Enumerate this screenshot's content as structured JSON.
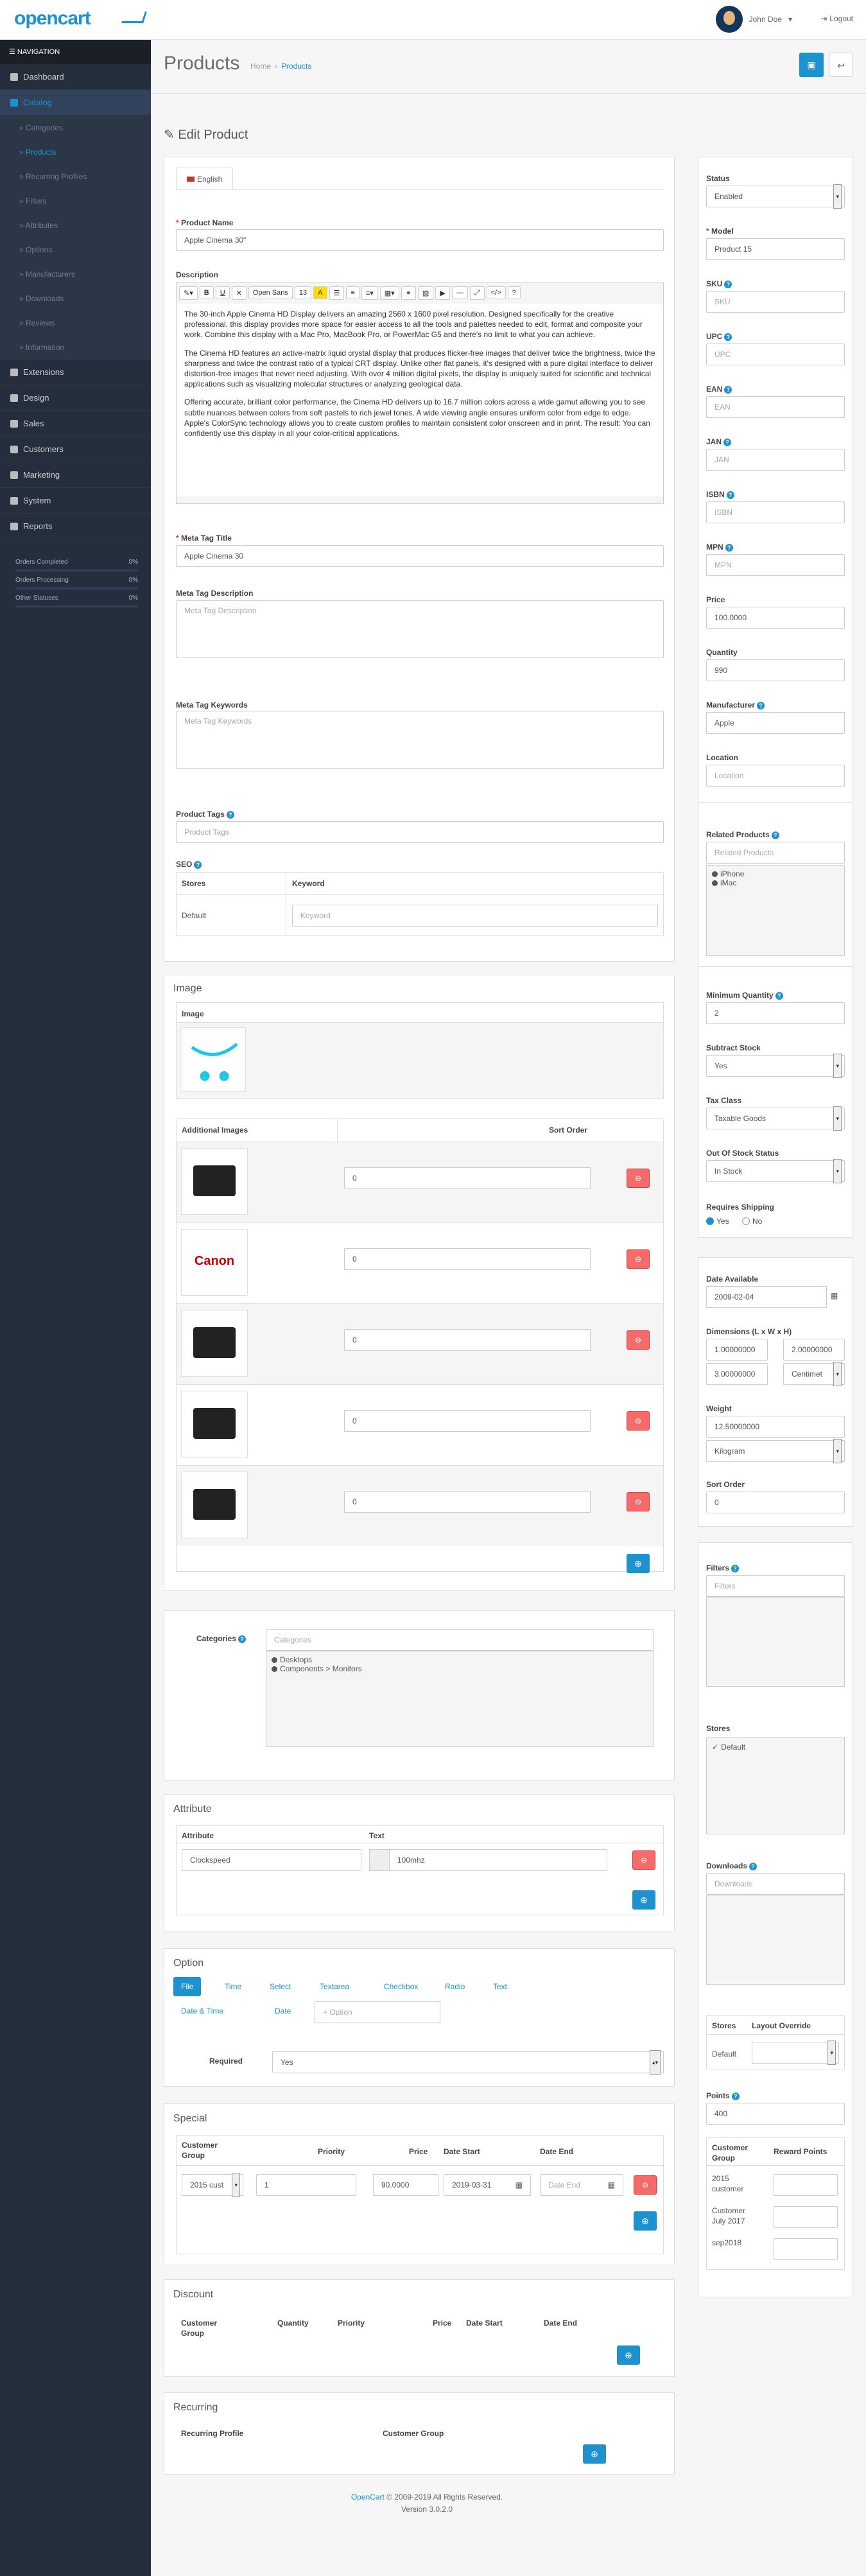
{
  "header": {
    "logo": "opencart",
    "user": "John Doe",
    "logout": "Logout"
  },
  "nav": {
    "title": "NAVIGATION",
    "items": [
      {
        "label": "Dashboard",
        "icon": "dashboard-icon"
      },
      {
        "label": "Catalog",
        "icon": "tag-icon"
      }
    ],
    "catalog_sub": [
      "Categories",
      "Products",
      "Recurring Profiles",
      "Filters",
      "Attributes",
      "Options",
      "Manufacturers",
      "Downloads",
      "Reviews",
      "Information"
    ],
    "rest": [
      {
        "label": "Extensions",
        "icon": "puzzle-icon"
      },
      {
        "label": "Design",
        "icon": "monitor-icon"
      },
      {
        "label": "Sales",
        "icon": "cart-icon"
      },
      {
        "label": "Customers",
        "icon": "user-icon"
      },
      {
        "label": "Marketing",
        "icon": "share-icon"
      },
      {
        "label": "System",
        "icon": "gear-icon"
      },
      {
        "label": "Reports",
        "icon": "bar-chart-icon"
      }
    ],
    "stats": [
      {
        "label": "Orders Completed",
        "value": "0%"
      },
      {
        "label": "Orders Processing",
        "value": "0%"
      },
      {
        "label": "Other Statuses",
        "value": "0%"
      }
    ]
  },
  "page": {
    "title": "Products",
    "breadcrumb_home": "Home",
    "breadcrumb_current": "Products",
    "panel_title": "Edit Product"
  },
  "general": {
    "tab": "English",
    "product_name_label": "Product Name",
    "product_name": "Apple Cinema 30\"",
    "description_label": "Description",
    "editor_font": "Open Sans",
    "editor_size": "13",
    "description": [
      "The 30-inch Apple Cinema HD Display delivers an amazing 2560 x 1600 pixel resolution. Designed specifically for the creative professional, this display provides more space for easier access to all the tools and palettes needed to edit, format and composite your work. Combine this display with a Mac Pro, MacBook Pro, or PowerMac G5 and there's no limit to what you can achieve.",
      "The Cinema HD features an active-matrix liquid crystal display that produces flicker-free images that deliver twice the brightness, twice the sharpness and twice the contrast ratio of a typical CRT display. Unlike other flat panels, it's designed with a pure digital interface to deliver distortion-free images that never need adjusting. With over 4 million digital pixels, the display is uniquely suited for scientific and technical applications such as visualizing molecular structures or analyzing geological data.",
      "Offering accurate, brilliant color performance, the Cinema HD delivers up to 16.7 million colors across a wide gamut allowing you to see subtle nuances between colors from soft pastels to rich jewel tones. A wide viewing angle ensures uniform color from edge to edge. Apple's ColorSync technology allows you to create custom profiles to maintain consistent color onscreen and in print. The result: You can confidently use this display in all your color-critical applications."
    ],
    "meta_title_label": "Meta Tag Title",
    "meta_title": "Apple Cinema 30",
    "meta_desc_label": "Meta Tag Description",
    "meta_desc_ph": "Meta Tag Description",
    "meta_kw_label": "Meta Tag Keywords",
    "meta_kw_ph": "Meta Tag Keywords",
    "tags_label": "Product Tags",
    "tags_ph": "Product Tags",
    "seo_label": "SEO",
    "seo_col1": "Stores",
    "seo_col2": "Keyword",
    "seo_store": "Default",
    "seo_kw_ph": "Keyword"
  },
  "image": {
    "title": "Image",
    "image_col": "Image",
    "add_col": "Additional Images",
    "sort_col": "Sort Order",
    "items": [
      {
        "icon": "camera-icon",
        "sort": "0"
      },
      {
        "icon": "canon-logo",
        "label": "Canon",
        "sort": "0"
      },
      {
        "icon": "laptop-icon",
        "sort": "0"
      },
      {
        "icon": "desktop-icon",
        "sort": "0"
      },
      {
        "icon": "camera-icon",
        "sort": "0"
      }
    ]
  },
  "categories": {
    "label": "Categories",
    "ph": "Categories",
    "items": [
      "Desktops",
      "Components > Monitors"
    ]
  },
  "attribute": {
    "title": "Attribute",
    "col1": "Attribute",
    "col2": "Text",
    "name": "Clockspeed",
    "text": "100mhz"
  },
  "option": {
    "title": "Option",
    "tabs": [
      "File",
      "Time",
      "Select",
      "Textarea",
      "Checkbox",
      "Radio",
      "Text",
      "Date & Time",
      "Date"
    ],
    "add_ph": "+ Option",
    "required_label": "Required",
    "required_value": "Yes"
  },
  "special": {
    "title": "Special",
    "cols": [
      "Customer Group",
      "Priority",
      "Price",
      "Date Start",
      "Date End"
    ],
    "group": "2015 cust",
    "priority": "1",
    "price": "90.0000",
    "date_start": "2019-03-31",
    "date_end_ph": "Date End"
  },
  "discount": {
    "title": "Discount",
    "cols": [
      "Customer Group",
      "Quantity",
      "Priority",
      "Price",
      "Date Start",
      "Date End"
    ]
  },
  "recurring": {
    "title": "Recurring",
    "cols": [
      "Recurring Profile",
      "Customer Group"
    ]
  },
  "footer": {
    "brand": "OpenCart",
    "copy": "© 2009-2019 All Rights Reserved.",
    "version": "Version 3.0.2.0"
  },
  "side": {
    "status_label": "Status",
    "status": "Enabled",
    "model_label": "Model",
    "model": "Product 15",
    "sku_label": "SKU",
    "sku_ph": "SKU",
    "upc_label": "UPC",
    "upc_ph": "UPC",
    "ean_label": "EAN",
    "ean_ph": "EAN",
    "jan_label": "JAN",
    "jan_ph": "JAN",
    "isbn_label": "ISBN",
    "isbn_ph": "ISBN",
    "mpn_label": "MPN",
    "mpn_ph": "MPN",
    "price_label": "Price",
    "price": "100.0000",
    "qty_label": "Quantity",
    "qty": "990",
    "mfr_label": "Manufacturer",
    "mfr": "Apple",
    "loc_label": "Location",
    "loc_ph": "Location",
    "related_label": "Related Products",
    "related_ph": "Related Products",
    "related": [
      "iPhone",
      "iMac"
    ],
    "minq_label": "Minimum Quantity",
    "minq": "2",
    "subtract_label": "Subtract Stock",
    "subtract": "Yes",
    "tax_label": "Tax Class",
    "tax": "Taxable Goods",
    "oos_label": "Out Of Stock Status",
    "oos": "In Stock",
    "ship_label": "Requires Shipping",
    "ship_yes": "Yes",
    "ship_no": "No",
    "date_label": "Date Available",
    "date": "2009-02-04",
    "dim_label": "Dimensions (L x W x H)",
    "dim_l": "1.00000000",
    "dim_w": "2.00000000",
    "dim_h": "3.00000000",
    "dim_unit": "Centimet",
    "weight_label": "Weight",
    "weight": "12.50000000",
    "weight_unit": "Kilogram",
    "sort_label": "Sort Order",
    "sort": "0",
    "filters_label": "Filters",
    "filters_ph": "Filters",
    "stores_label": "Stores",
    "store": "Default",
    "downloads_label": "Downloads",
    "downloads_ph": "Downloads",
    "layout_col1": "Stores",
    "layout_col2": "Layout Override",
    "layout_store": "Default",
    "points_label": "Points",
    "points": "400",
    "reward_col1": "Customer Group",
    "reward_col2": "Reward Points",
    "reward_groups": [
      "2015 customer",
      "Customer July 2017",
      "sep2018"
    ]
  }
}
